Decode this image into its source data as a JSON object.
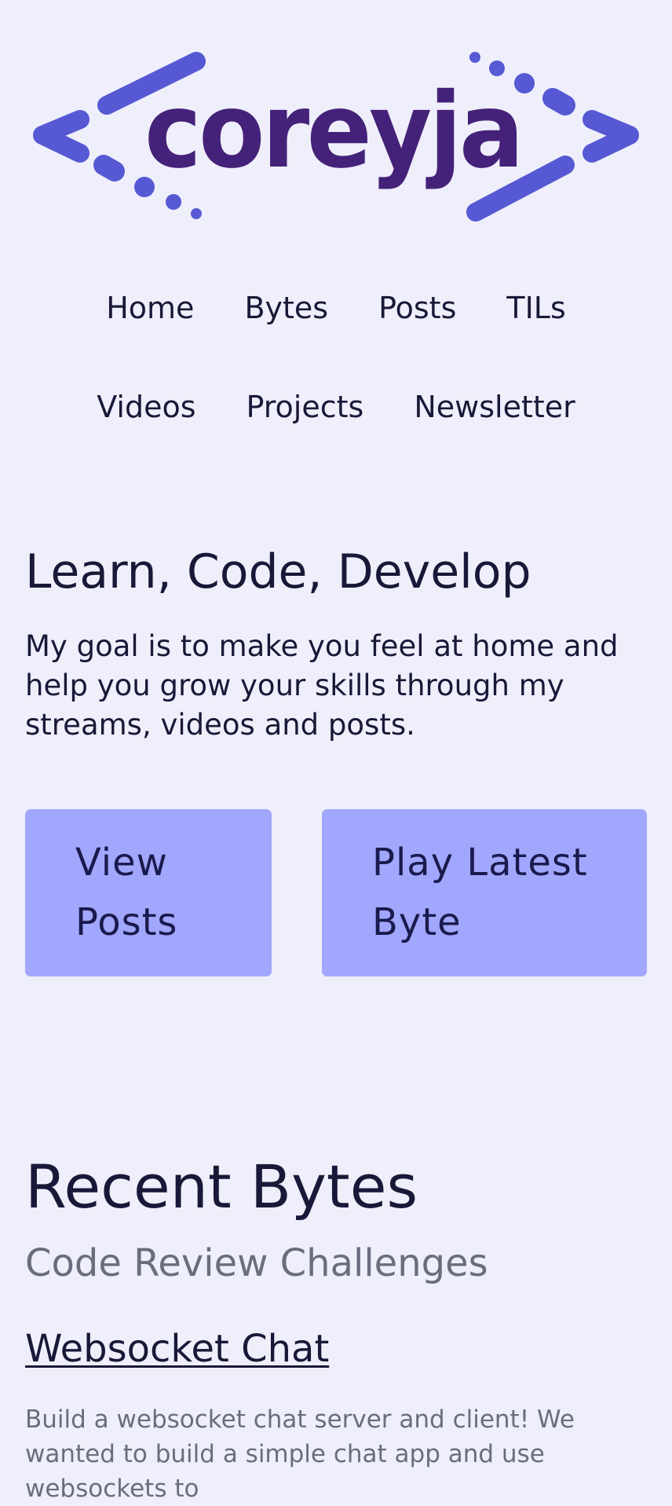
{
  "logo": {
    "text": "coreyja",
    "colors": {
      "brackets": "#5659d3",
      "text": "#452279"
    }
  },
  "nav": {
    "items": [
      {
        "label": "Home"
      },
      {
        "label": "Bytes"
      },
      {
        "label": "Posts"
      },
      {
        "label": "TILs"
      },
      {
        "label": "Videos"
      },
      {
        "label": "Projects"
      },
      {
        "label": "Newsletter"
      }
    ]
  },
  "hero": {
    "title": "Learn, Code, Develop",
    "text": "My goal is to make you feel at home and help you grow your skills through my streams, videos and posts.",
    "buttons": {
      "view_posts": "View Posts",
      "play_latest_byte": "Play Latest Byte"
    }
  },
  "recent_bytes": {
    "title": "Recent Bytes",
    "subtitle": "Code Review Challenges",
    "items": [
      {
        "title": "Websocket Chat",
        "description": "Build a websocket chat server and client! We wanted to build a simple chat app and use websockets to"
      }
    ]
  },
  "theme": {
    "background": "#efeffb",
    "button": "#a1a7fd",
    "text": "#1a1838",
    "muted": "#6a6d7e"
  }
}
